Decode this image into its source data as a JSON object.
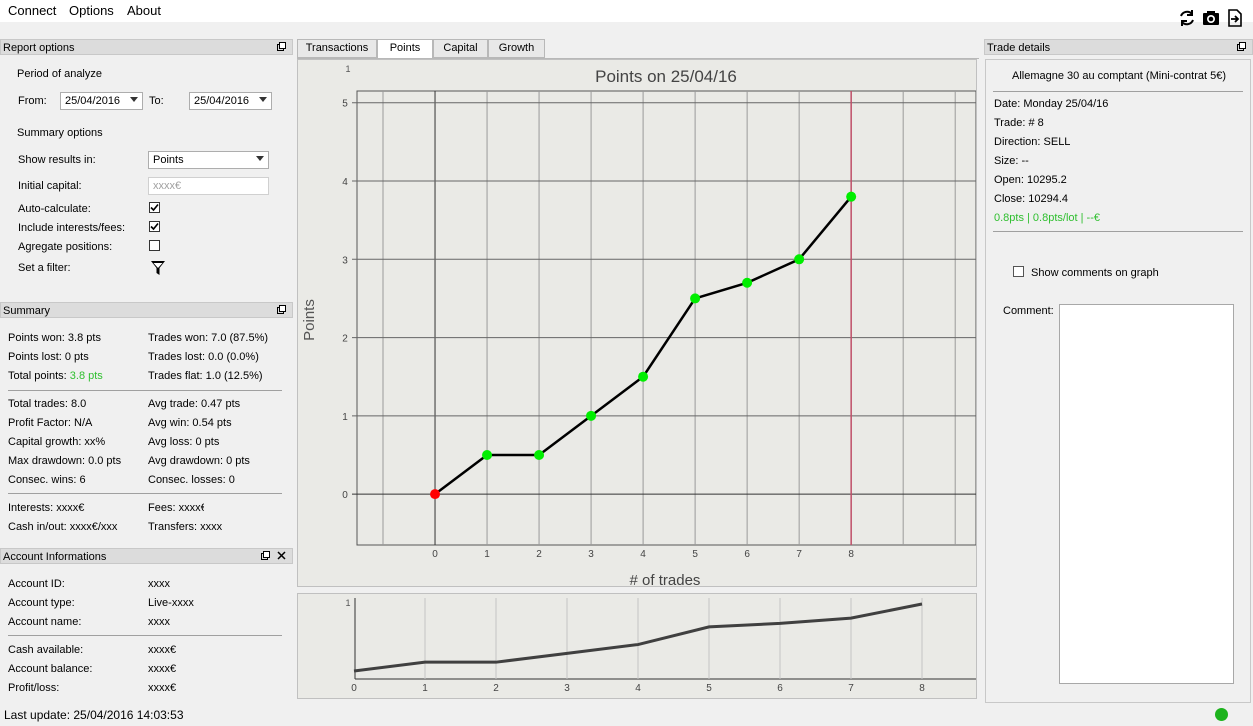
{
  "menu": {
    "connect": "Connect",
    "options": "Options",
    "about": "About"
  },
  "toolbar": {
    "refresh_icon": "refresh-icon",
    "camera_icon": "camera-icon",
    "export_icon": "export-icon"
  },
  "report_options": {
    "title": "Report options",
    "period_label": "Period of analyze",
    "from_label": "From:",
    "from_value": "25/04/2016",
    "to_label": "To:",
    "to_value": "25/04/2016",
    "summary_options_label": "Summary options",
    "show_results_label": "Show results in:",
    "show_results_value": "Points",
    "initial_capital_label": "Initial capital:",
    "initial_capital_placeholder": "xxxx€",
    "auto_calc_label": "Auto-calculate:",
    "auto_calc": true,
    "include_fees_label": "Include interests/fees:",
    "include_fees": true,
    "aggregate_label": "Agregate positions:",
    "aggregate": false,
    "filter_label": "Set a filter:"
  },
  "summary": {
    "title": "Summary",
    "points_won": "Points won: 3.8 pts",
    "trades_won": "Trades won: 7.0 (87.5%)",
    "points_lost": "Points lost: 0 pts",
    "trades_lost": "Trades lost: 0.0 (0.0%)",
    "total_points_label": "Total points: ",
    "total_points_value": "3.8 pts",
    "trades_flat": "Trades flat: 1.0 (12.5%)",
    "total_trades": "Total trades: 8.0",
    "avg_trade": "Avg trade: 0.47 pts",
    "profit_factor": "Profit Factor: N/A",
    "avg_win": "Avg win: 0.54 pts",
    "capital_growth": "Capital growth: xx%",
    "avg_loss": "Avg loss: 0 pts",
    "max_drawdown": "Max drawdown: 0.0 pts",
    "avg_drawdown": "Avg drawdown: 0 pts",
    "consec_wins": "Consec. wins: 6",
    "consec_losses": "Consec. losses: 0",
    "interests": "Interests: xxxx€",
    "fees": "Fees: xxxx€",
    "cash_inout": "Cash in/out: xxxx€/xxx",
    "transfers": "Transfers: xxxx"
  },
  "account": {
    "title": "Account Informations",
    "id_label": "Account ID:",
    "id_value": "xxxx",
    "type_label": "Account type:",
    "type_value": "Live-xxxx",
    "name_label": "Account name:",
    "name_value": "xxxx",
    "cash_label": "Cash available:",
    "cash_value": "xxxx€",
    "balance_label": "Account balance:",
    "balance_value": "xxxx€",
    "pl_label": "Profit/loss:",
    "pl_value": "xxxx€"
  },
  "status": {
    "last_update": "Last update: 25/04/2016 14:03:53",
    "connection_color": "#1db31d"
  },
  "tabs": [
    "Transactions",
    "Points",
    "Capital",
    "Growth"
  ],
  "active_tab": "Points",
  "chart_data": [
    {
      "type": "line",
      "title": "Points on 25/04/16",
      "xlabel": "# of trades",
      "ylabel": "Points",
      "x": [
        0,
        1,
        2,
        3,
        4,
        5,
        6,
        7,
        8
      ],
      "values": [
        0,
        0.5,
        0.5,
        1.0,
        1.5,
        2.5,
        2.7,
        3.0,
        3.8
      ],
      "xlim": [
        -1.5,
        10.4
      ],
      "ylim": [
        -0.65,
        5.15
      ],
      "yticks": [
        0,
        1,
        2,
        3,
        4,
        5
      ],
      "corner_label": "1",
      "grid": true,
      "first_point_color": "#ff0000",
      "point_color": "#00ee00",
      "line_color": "#000000",
      "marker_line_x": 8,
      "marker_line_color": "#c0506a"
    },
    {
      "type": "area",
      "x": [
        0,
        1,
        2,
        3,
        4,
        5,
        6,
        7,
        8
      ],
      "values": [
        0,
        0.5,
        0.5,
        1.0,
        1.5,
        2.5,
        2.7,
        3.0,
        3.8
      ],
      "corner_label": "1",
      "line_color": "#404040"
    }
  ],
  "trade_details": {
    "title": "Trade details",
    "instrument": "Allemagne 30 au comptant (Mini-contrat 5€)",
    "date": "Date: Monday 25/04/16",
    "trade": "Trade: # 8",
    "direction": "Direction: SELL",
    "size": "Size: --",
    "open": "Open: 10295.2",
    "close": "Close: 10294.4",
    "result": "0.8pts | 0.8pts/lot | --€",
    "show_comments_label": "Show comments on graph",
    "comment_label": "Comment:"
  }
}
